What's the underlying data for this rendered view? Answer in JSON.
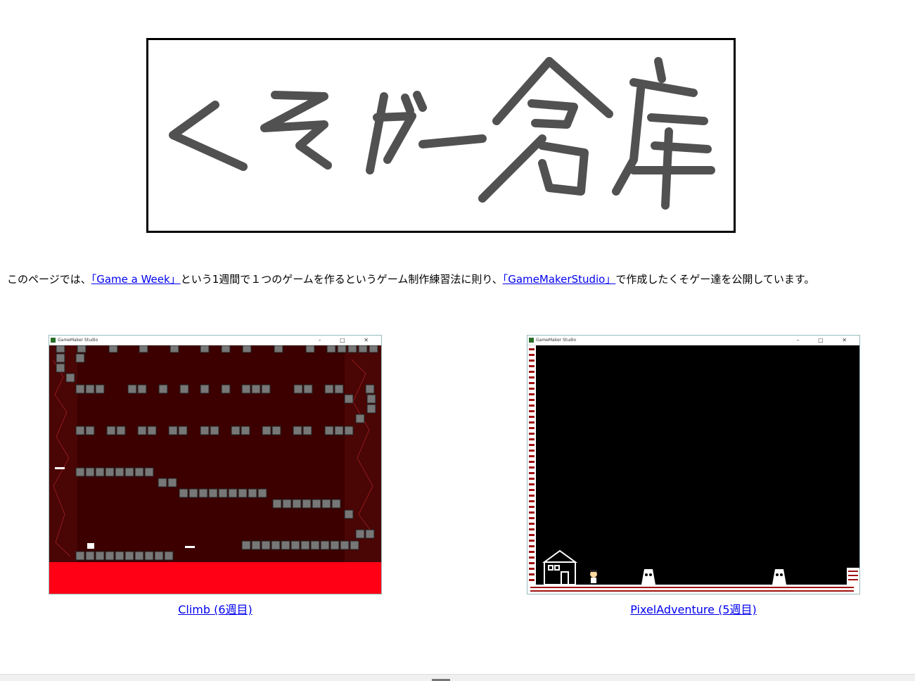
{
  "banner": {
    "logo_text": "くそゲー倉庫"
  },
  "intro": {
    "part1": "このページでは、",
    "link1": "「Game a Week」",
    "part2": "という1週間で１つのゲームを作るというゲーム制作練習法に則り、",
    "link2": "「GameMakerStudio」",
    "part3": "で作成したくそゲー達を公開しています。"
  },
  "games": [
    {
      "window_title": "GameMaker Studio",
      "caption": "Climb (6週目)"
    },
    {
      "window_title": "GameMaker Studio",
      "caption": "PixelAdventure (5週目)"
    }
  ],
  "window_buttons": "–  □  ✕",
  "colors": {
    "link": "#0000ee",
    "lava": "#ff0015",
    "climb_bg": "#3c0000",
    "adventure_bg": "#000000"
  }
}
